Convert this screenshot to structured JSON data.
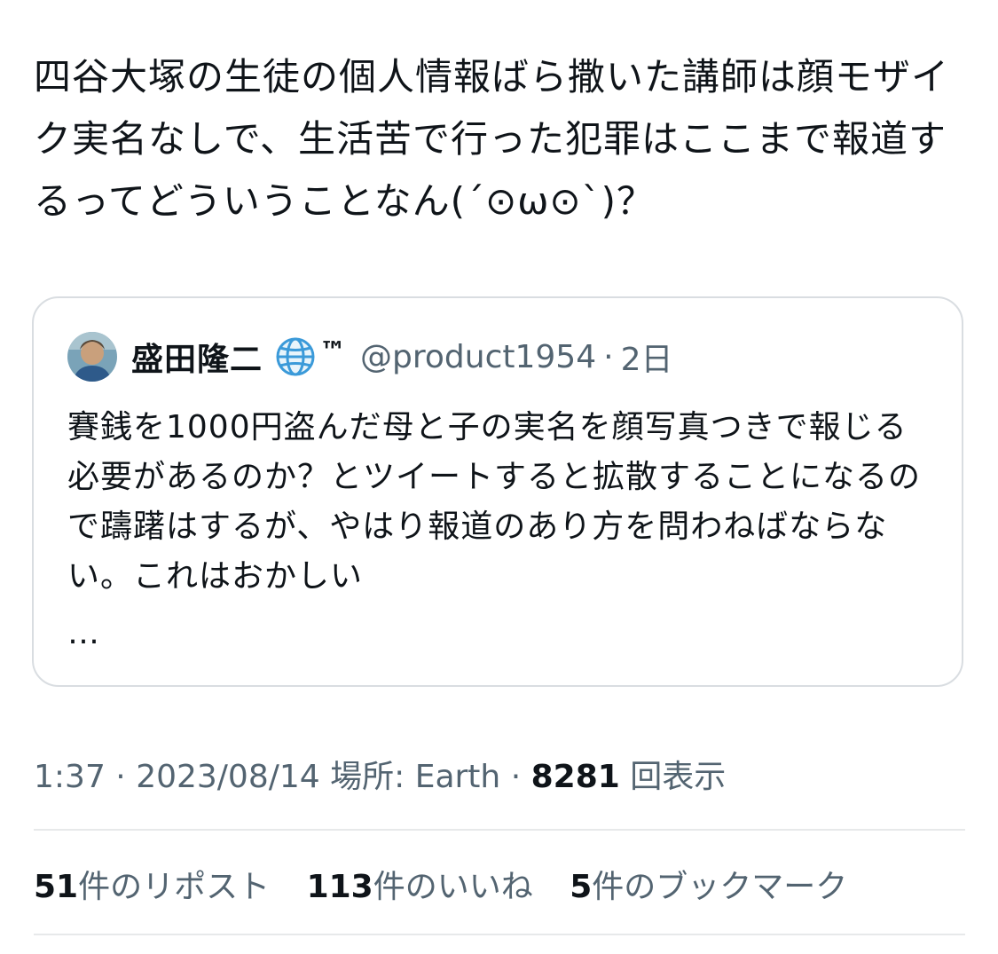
{
  "tweet": {
    "text": "四谷大塚の生徒の個人情報ばら撒いた講師は顔モザイク実名なしで、生活苦で行った犯罪はここまで報道するってどういうことなん(´⊙ω⊙`)？"
  },
  "quote": {
    "author_name": "盛田隆二",
    "author_emoji": "🌐",
    "author_tm": "™",
    "handle": "@product1954",
    "separator": "·",
    "time": "2日",
    "body": "賽銭を1000円盗んだ母と子の実名を顔写真つきで報じる必要があるのか？とツイートすると拡散することになるので躊躇はするが、やはり報道のあり方を問わねばならない。これはおかしい",
    "more": "…"
  },
  "meta": {
    "time": "1:37",
    "sep1": " · ",
    "date": "2023/08/14",
    "location_label": " 場所: Earth",
    "sep2": " · ",
    "views_count": "8281",
    "views_label": " 回表示"
  },
  "stats": {
    "reposts_count": "51",
    "reposts_label": "件のリポスト",
    "likes_count": "113",
    "likes_label": "件のいいね",
    "bookmarks_count": "5",
    "bookmarks_label": "件のブックマーク"
  },
  "colors": {
    "text_primary": "#0f1419",
    "text_secondary": "#536471",
    "border": "#d9dde1",
    "divider": "#e7e9ea"
  }
}
